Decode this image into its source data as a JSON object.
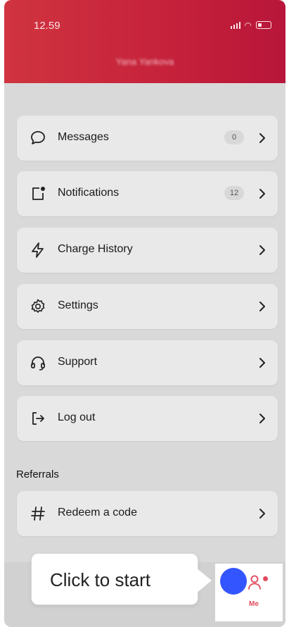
{
  "status_bar": {
    "time": "12.59"
  },
  "header": {
    "name": "Yana Yankova"
  },
  "menu": [
    {
      "id": "messages",
      "label": "Messages",
      "badge": "0",
      "icon": "chat-bubble-icon"
    },
    {
      "id": "notifications",
      "label": "Notifications",
      "badge": "12",
      "icon": "notification-square-icon"
    },
    {
      "id": "charge-history",
      "label": "Charge History",
      "icon": "lightning-icon"
    },
    {
      "id": "settings",
      "label": "Settings",
      "icon": "gear-icon"
    },
    {
      "id": "support",
      "label": "Support",
      "icon": "headset-icon"
    },
    {
      "id": "logout",
      "label": "Log out",
      "icon": "logout-icon"
    }
  ],
  "referrals": {
    "title": "Referrals",
    "item": {
      "label": "Redeem a code",
      "icon": "hash-icon"
    }
  },
  "tooltip": {
    "text": "Click to start"
  },
  "tab_bar": {
    "me_label": "Me"
  },
  "colors": {
    "header": "#c5213b",
    "accent_blue": "#3355ff",
    "tab_accent": "#e04a5a"
  }
}
